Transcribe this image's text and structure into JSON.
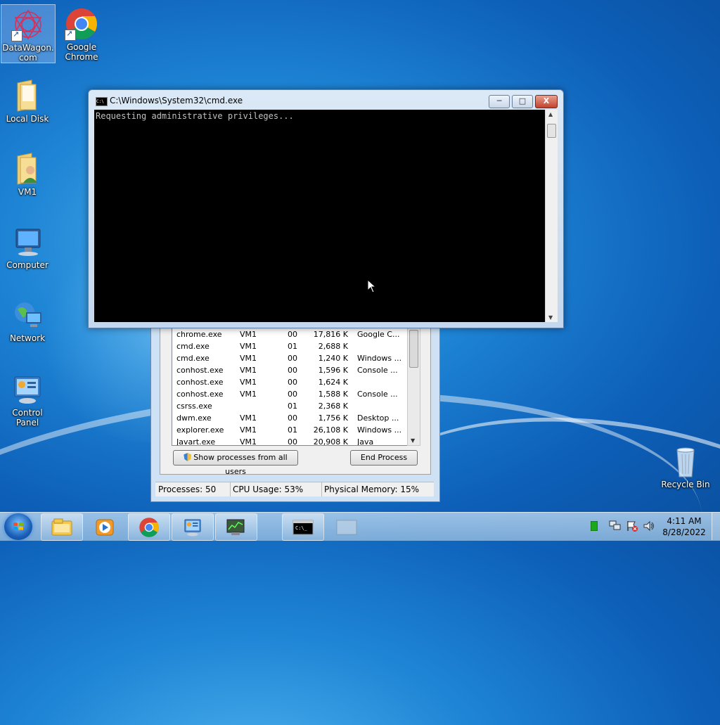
{
  "desktop": {
    "icons": [
      {
        "label": "DataWagon.com",
        "icon": "datawagon-icon"
      },
      {
        "label": "Google Chrome",
        "icon": "chrome-icon"
      },
      {
        "label": "Local Disk",
        "icon": "folder-icon"
      },
      {
        "label": "VM1",
        "icon": "user-folder-icon"
      },
      {
        "label": "Computer",
        "icon": "computer-icon"
      },
      {
        "label": "Network",
        "icon": "network-icon"
      },
      {
        "label": "Control Panel",
        "icon": "control-panel-icon"
      },
      {
        "label": "Recycle Bin",
        "icon": "recycle-bin-icon"
      }
    ]
  },
  "cmd": {
    "title": "C:\\Windows\\System32\\cmd.exe",
    "output": "Requesting administrative privileges...",
    "minimize": "─",
    "maximize": "□",
    "close": "X"
  },
  "taskmanager": {
    "processes": [
      {
        "name": "chrome.exe",
        "user": "VM1",
        "cpu": "00",
        "mem": "17,816 K",
        "desc": "Google C..."
      },
      {
        "name": "cmd.exe",
        "user": "VM1",
        "cpu": "01",
        "mem": "2,688 K",
        "desc": ""
      },
      {
        "name": "cmd.exe",
        "user": "VM1",
        "cpu": "00",
        "mem": "1,240 K",
        "desc": "Windows ..."
      },
      {
        "name": "conhost.exe",
        "user": "VM1",
        "cpu": "00",
        "mem": "1,596 K",
        "desc": "Console ..."
      },
      {
        "name": "conhost.exe",
        "user": "VM1",
        "cpu": "00",
        "mem": "1,624 K",
        "desc": ""
      },
      {
        "name": "conhost.exe",
        "user": "VM1",
        "cpu": "00",
        "mem": "1,588 K",
        "desc": "Console ..."
      },
      {
        "name": "csrss.exe",
        "user": "",
        "cpu": "01",
        "mem": "2,368 K",
        "desc": ""
      },
      {
        "name": "dwm.exe",
        "user": "VM1",
        "cpu": "00",
        "mem": "1,756 K",
        "desc": "Desktop ..."
      },
      {
        "name": "explorer.exe",
        "user": "VM1",
        "cpu": "01",
        "mem": "26,108 K",
        "desc": "Windows ..."
      },
      {
        "name": "Javart.exe",
        "user": "VM1",
        "cpu": "00",
        "mem": "20,908 K",
        "desc": "Java"
      }
    ],
    "show_all_label": "Show processes from all users",
    "end_process_label": "End Process",
    "status": {
      "processes": "Processes: 50",
      "cpu": "CPU Usage: 53%",
      "memory": "Physical Memory: 15%"
    }
  },
  "taskbar": {
    "items": [
      "start-orb",
      "explorer-icon",
      "media-player-icon",
      "chrome-icon",
      "control-panel-icon",
      "task-manager-icon",
      "cmd-icon",
      "window-icon"
    ],
    "clock": {
      "time": "4:11 AM",
      "date": "8/28/2022"
    }
  },
  "colors": {
    "console_bg": "#000000",
    "console_text": "#c0c0c0",
    "accent": "#1f86d6"
  }
}
